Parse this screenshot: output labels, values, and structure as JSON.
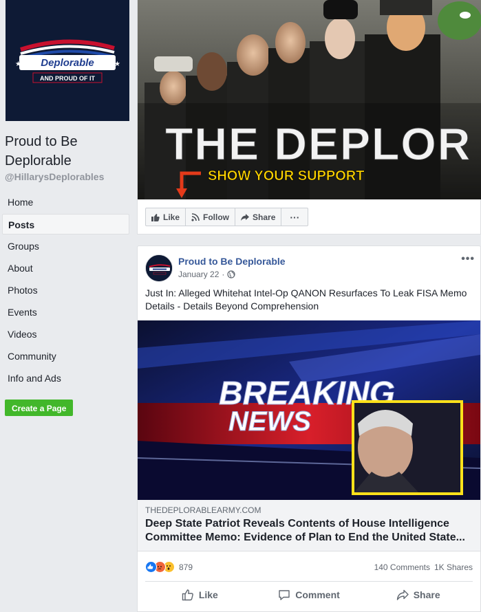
{
  "sidebar": {
    "page_name": "Proud to Be Deplorable",
    "page_handle": "@HillarysDeplorables",
    "logo_text": "Deplorable",
    "logo_tagline": "AND PROUD OF IT",
    "nav": [
      {
        "label": "Home"
      },
      {
        "label": "Posts"
      },
      {
        "label": "Groups"
      },
      {
        "label": "About"
      },
      {
        "label": "Photos"
      },
      {
        "label": "Events"
      },
      {
        "label": "Videos"
      },
      {
        "label": "Community"
      },
      {
        "label": "Info and Ads"
      }
    ],
    "create_page_label": "Create a Page"
  },
  "cover": {
    "headline": "THE DEPLOR",
    "subline": "SHOW YOUR SUPPORT",
    "actions": {
      "like": "Like",
      "follow": "Follow",
      "share": "Share",
      "more": "···"
    }
  },
  "post": {
    "author": "Proud to Be Deplorable",
    "date": "January 22",
    "more": "•••",
    "text": "Just In: Alleged Whitehat Intel-Op QANON Resurfaces To Leak FISA Memo Details - Details Beyond Comprehension",
    "link_image_text_1": "BREAKING",
    "link_image_text_2": "NEWS",
    "link_domain": "THEDEPLORABLEARMY.COM",
    "link_title_1": "Deep State Patriot Reveals Contents of House Intelligence",
    "link_title_2": "Committee Memo: Evidence of Plan to End the United State...",
    "reaction_count": "879",
    "comments": "140 Comments",
    "shares": "1K Shares",
    "actions": {
      "like": "Like",
      "comment": "Comment",
      "share": "Share"
    }
  },
  "colors": {
    "link_blue": "#365899",
    "create_green": "#42b72a",
    "like_blue": "#1877f2",
    "angry_orange": "#f0643a",
    "wow_yellow": "#fbc02d"
  }
}
